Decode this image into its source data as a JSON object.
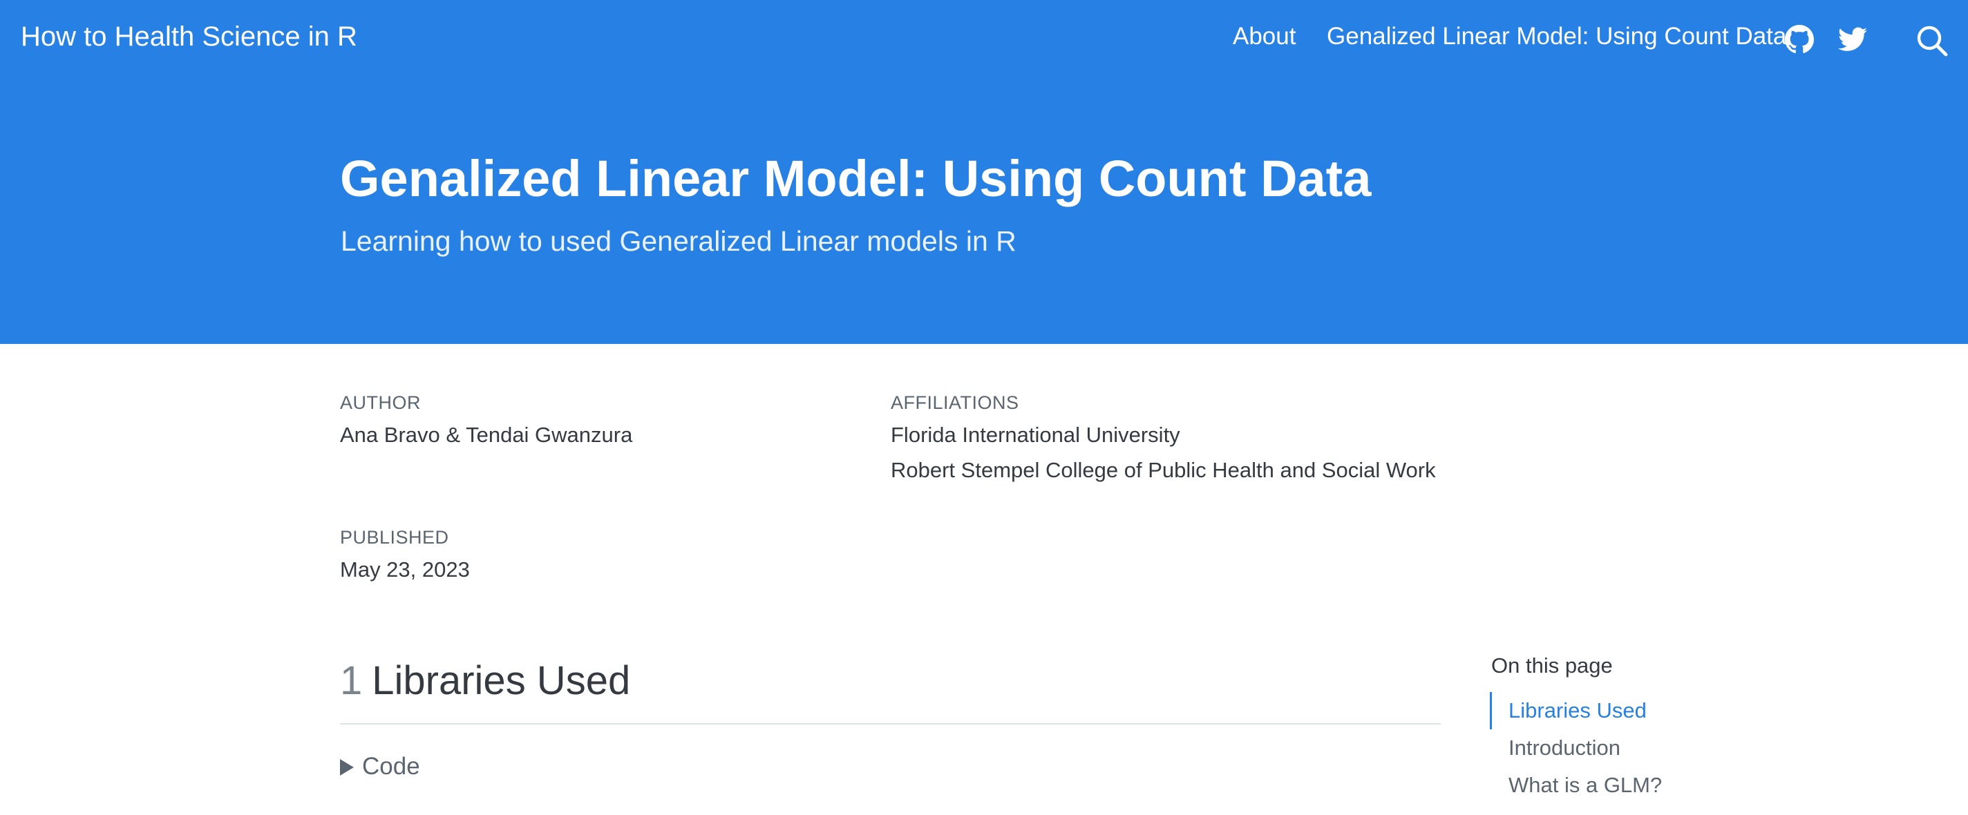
{
  "navbar": {
    "brand": "How to Health Science in R",
    "links": [
      "About",
      "Genalized Linear Model: Using Count Data"
    ],
    "icons": [
      "github-icon",
      "twitter-icon",
      "search-icon"
    ],
    "background_color": "#2780e3"
  },
  "hero": {
    "title": "Genalized Linear Model: Using Count Data",
    "subtitle": "Learning how to used Generalized Linear models in R"
  },
  "meta": {
    "author_label": "AUTHOR",
    "author": "Ana Bravo & Tendai Gwanzura",
    "affiliations_label": "AFFILIATIONS",
    "affiliations": [
      "Florida International University",
      "Robert Stempel College of Public Health and Social Work"
    ],
    "published_label": "PUBLISHED",
    "published": "May 23, 2023"
  },
  "content": {
    "section_number": "1",
    "section_title": "Libraries Used",
    "code_toggle": "Code"
  },
  "toc": {
    "title": "On this page",
    "items": [
      "Libraries Used",
      "Introduction",
      "What is a GLM?"
    ],
    "active_index": 0,
    "accent_color": "#2780e3"
  }
}
